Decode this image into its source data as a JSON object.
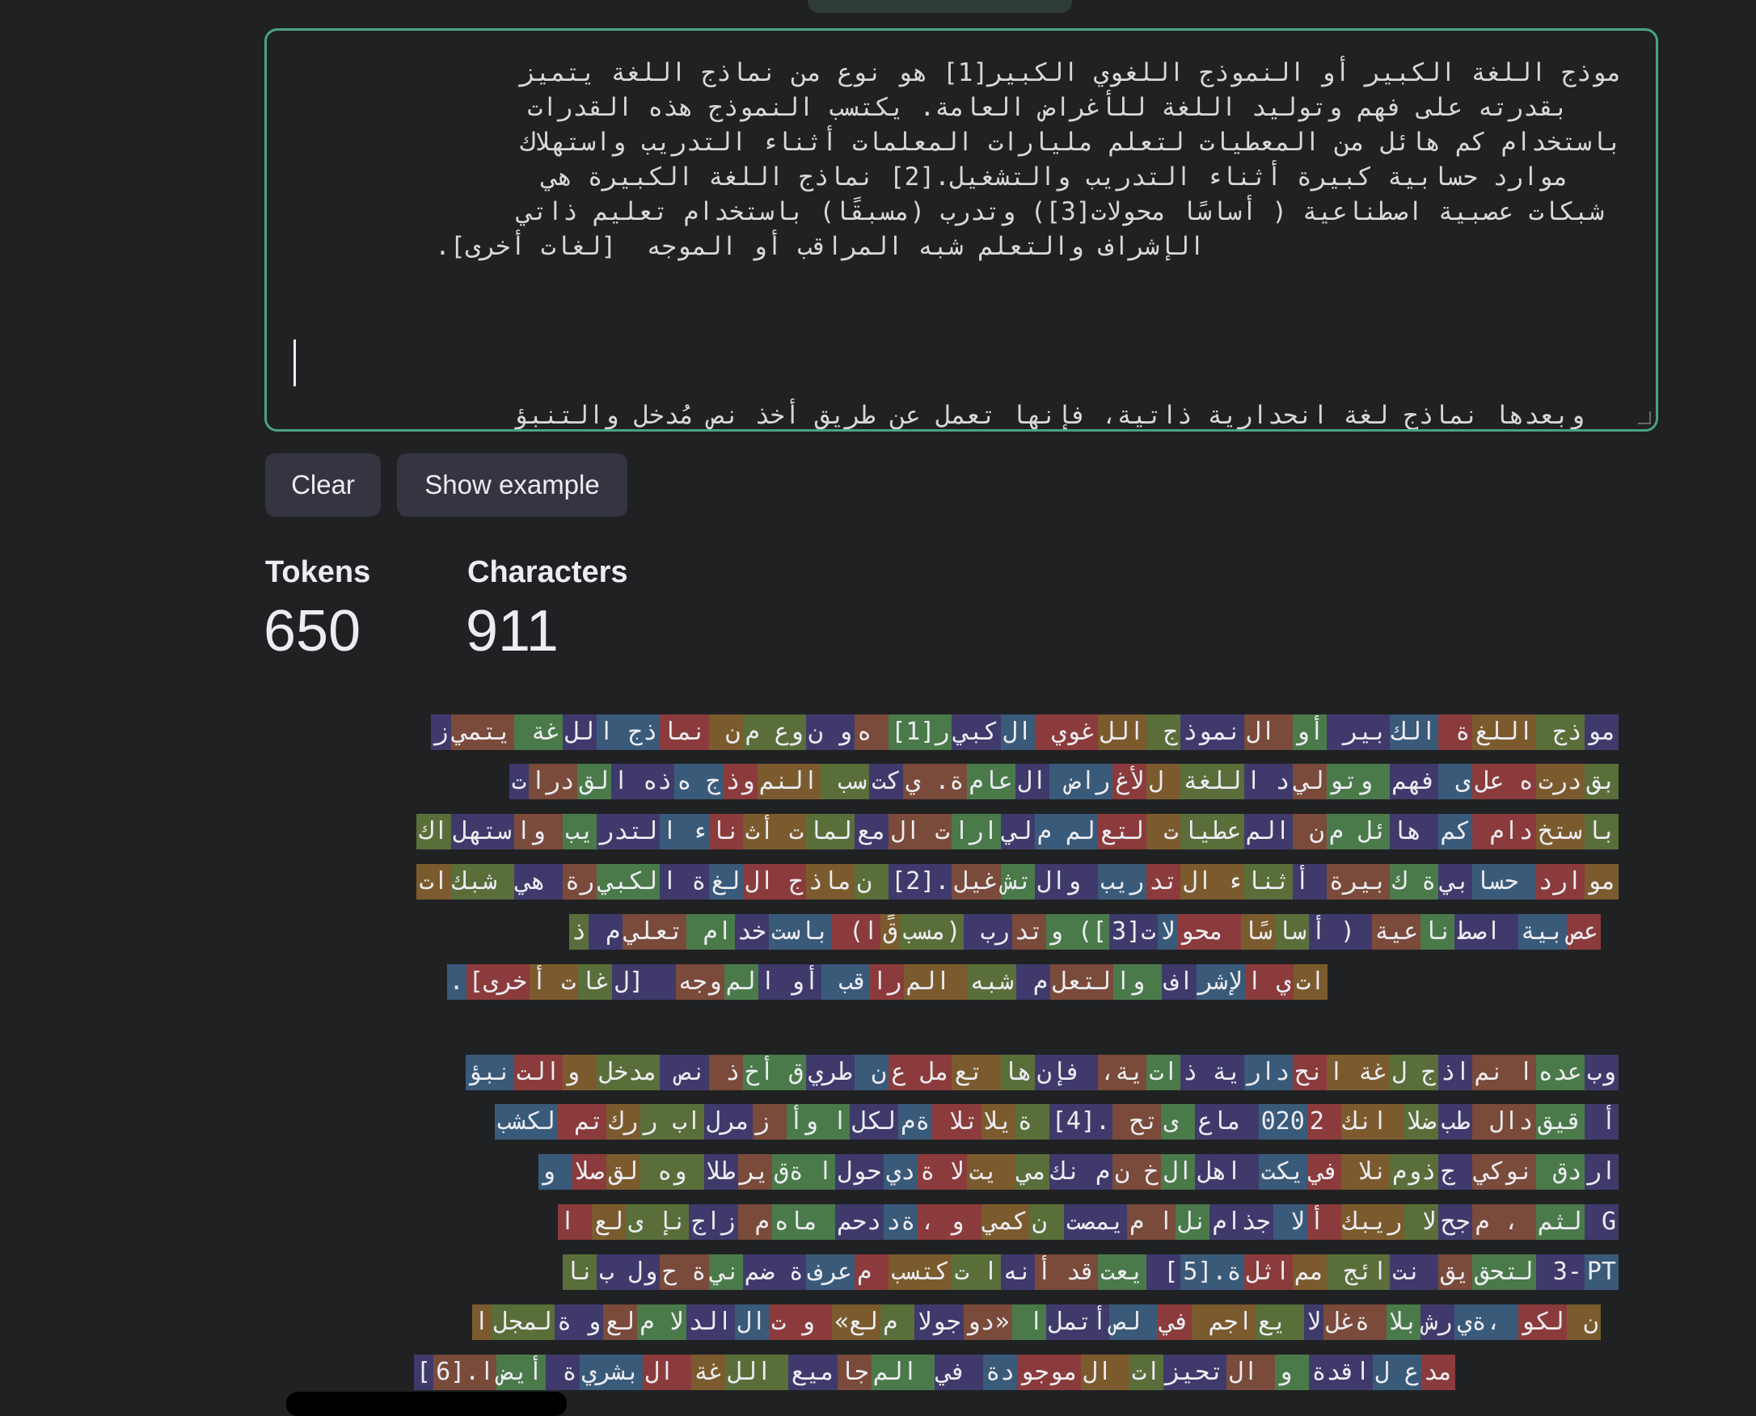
{
  "editor": {
    "lines": [
      "موذج اللغة الكبير أو النموذج اللغوي الكبير[1] هو نوع من نماذج اللغة يتميز",
      "بقدرته على فهم وتوليد اللغة للأغراض العامة. يكتسب النموذج هذه القدرات",
      "باستخدام كم هائل من المعطيات لتعلم مليارات المعلمات أثناء التدريب واستهلاك",
      "موارد حسابية كبيرة أثناء التدريب والتشغيل.[2] نماذج اللغة الكبيرة هي",
      "شبكات عصبية اصطناعية ( أساسًا محولات[3]) وتدرب (مسبقًا) باستخدام تعليم ذاتي",
      "الإشراف والتعلم شبه المراقب أو الموجه  [لغات أخرى]."
    ],
    "after_caret": "وبعدها نماذج لغة انحدارية ذاتية، فإنها تعمل عن طريق أخذ نص مُدخل والتنبؤ"
  },
  "buttons": {
    "clear": "Clear",
    "example": "Show example"
  },
  "stats": {
    "tokens_label": "Tokens",
    "tokens_value": "650",
    "chars_label": "Characters",
    "chars_value": "911"
  },
  "token_colors": [
    "#3f3a6b",
    "#5a6e3a",
    "#7b5b2e",
    "#8b3b3b",
    "#3a5a7a",
    "#3f3a6b",
    "#4a7a4a",
    "#7a4a3a"
  ],
  "tokens": {
    "p1": [
      "موذج اللغة الكبير أو النموذج اللغوي الكبير[1] هو نوع من نماذج اللغة يتميز",
      "بقدرته على فهم وتوليد اللغة للأغراض العامة. يكتسب النموذج هذه القدرات",
      "باستخدام كم هائل من المعطيات لتعلم مليارات المعلمات أثناء التدريب واستهلاك",
      "موارد حسابية كبيرة أثناء التدريب والتشغيل.[2] نماذج اللغة الكبيرة هي شبكات",
      "عصبية اصطناعية ( أساسًا محولات[3]) وتدرب (مسبقًا) باستخدام تعليم ذ",
      "اتي الإشراف والتعلم شبه المراقب أو الموجه  [لغات أخرى]."
    ],
    "p2": [
      "وبعدها نماذج لغة انحدارية ذاتية، فإنها تعمل عن طريق أخذ نص مدخل والتنبؤ",
      "أ قيقدال طبضلا انك 2020 ماع ىتح .[4] ةيلاتلا ةملكلا وأ زمرلاب رركتم لكشب",
      "اردق نوكي جذومنلا فييكت اهلالخ نم نكمي يتلا ةديحولا ةقيرطلا وه لقصلا و",
      "G لثم ، مجحلا ريبك ألا جذامنلا ميمصت نكمي و ،ةددحم ماهم زاجنإ ىلع ا",
      "PT-3 لتحقيق نتائج مماثلة.[5] يعتقد أنها تكتسب معرفة ضمنية حول بنا",
      "ن لكو ،ةيرشبلا ةغللا يعاجم في لصأتملا «دوجولا ملع» و تالالدلا ملعو ةلمجلا",
      "مدع لاقدة و التحيزات الموجودة في المجاميع اللغة البشرية أيضا.[6]"
    ]
  }
}
